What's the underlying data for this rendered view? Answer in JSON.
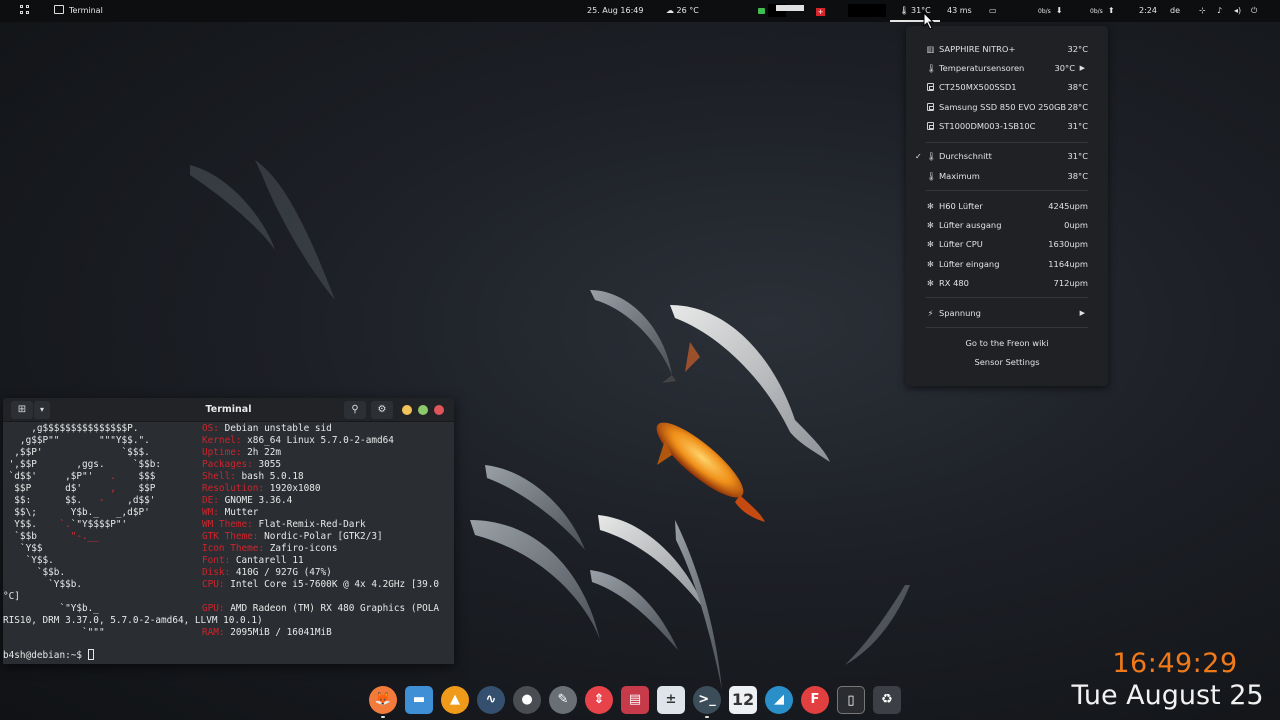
{
  "topbar": {
    "app_name": "Terminal",
    "datetime": "25. Aug  16:49",
    "weather": "26 °C",
    "flag_symbol": "+",
    "temperature": "31°C",
    "ping": "43 ms",
    "net_down": "0b/s",
    "net_up": "0b/s",
    "uptime": "2:24",
    "keyboard_layout": "de"
  },
  "freon": {
    "gpu": {
      "label": "SAPPHIRE NITRO+",
      "value": "32°C"
    },
    "sensors": {
      "label": "Temperatursensoren",
      "value": "30°C"
    },
    "drives": [
      {
        "label": "CT250MX500SSD1",
        "value": "38°C"
      },
      {
        "label": "Samsung SSD 850 EVO 250GB",
        "value": "28°C"
      },
      {
        "label": "ST1000DM003-1SB10C",
        "value": "31°C"
      }
    ],
    "average": {
      "label": "Durchschnitt",
      "value": "31°C",
      "check": "✓"
    },
    "maximum": {
      "label": "Maximum",
      "value": "38°C"
    },
    "fans": [
      {
        "label": "H60 Lüfter",
        "value": "4245upm"
      },
      {
        "label": "Lüfter ausgang",
        "value": "0upm"
      },
      {
        "label": "Lüfter CPU",
        "value": "1630upm"
      },
      {
        "label": "Lüfter eingang",
        "value": "1164upm"
      },
      {
        "label": "RX 480",
        "value": "712upm"
      }
    ],
    "voltage": {
      "label": "Spannung"
    },
    "wiki_link": "Go to the Freon wiki",
    "settings_link": "Sensor Settings"
  },
  "terminal": {
    "title": "Terminal",
    "info": [
      {
        "key": "OS:",
        "val": " Debian unstable sid"
      },
      {
        "key": "Kernel:",
        "val": " x86_64 Linux 5.7.0-2-amd64"
      },
      {
        "key": "Uptime:",
        "val": " 2h 22m"
      },
      {
        "key": "Packages:",
        "val": " 3055"
      },
      {
        "key": "Shell:",
        "val": " bash 5.0.18"
      },
      {
        "key": "Resolution:",
        "val": " 1920x1080"
      },
      {
        "key": "DE:",
        "val": " GNOME 3.36.4"
      },
      {
        "key": "WM:",
        "val": " Mutter"
      },
      {
        "key": "WM Theme:",
        "val": " Flat-Remix-Red-Dark"
      },
      {
        "key": "GTK Theme:",
        "val": " Nordic-Polar [GTK2/3]"
      },
      {
        "key": "Icon Theme:",
        "val": " Zafiro-icons"
      },
      {
        "key": "Font:",
        "val": " Cantarell 11"
      },
      {
        "key": "Disk:",
        "val": " 410G / 927G (47%)"
      },
      {
        "key": "CPU:",
        "val": " Intel Core i5-7600K @ 4x 4.2GHz [39.0"
      }
    ],
    "cpu_wrap": "°C]",
    "gpu_key": "GPU:",
    "gpu_val": " AMD Radeon (TM) RX 480 Graphics (POLA",
    "gpu_wrap": "RIS10, DRM 3.37.0, 5.7.0-2-amd64, LLVM 10.0.1)",
    "ram_key": "RAM:",
    "ram_val": " 2095MiB / 16041MiB",
    "prompt": "b4sh@debian:~$ "
  },
  "dock": {
    "calendar_day": "12"
  },
  "desktop_clock": {
    "time": "16:49:29",
    "date": "Tue August 25"
  },
  "colors": {
    "accent_red": "#d0232a",
    "clock_orange": "#f07a1a",
    "panel_bg": "#0d0e10"
  }
}
